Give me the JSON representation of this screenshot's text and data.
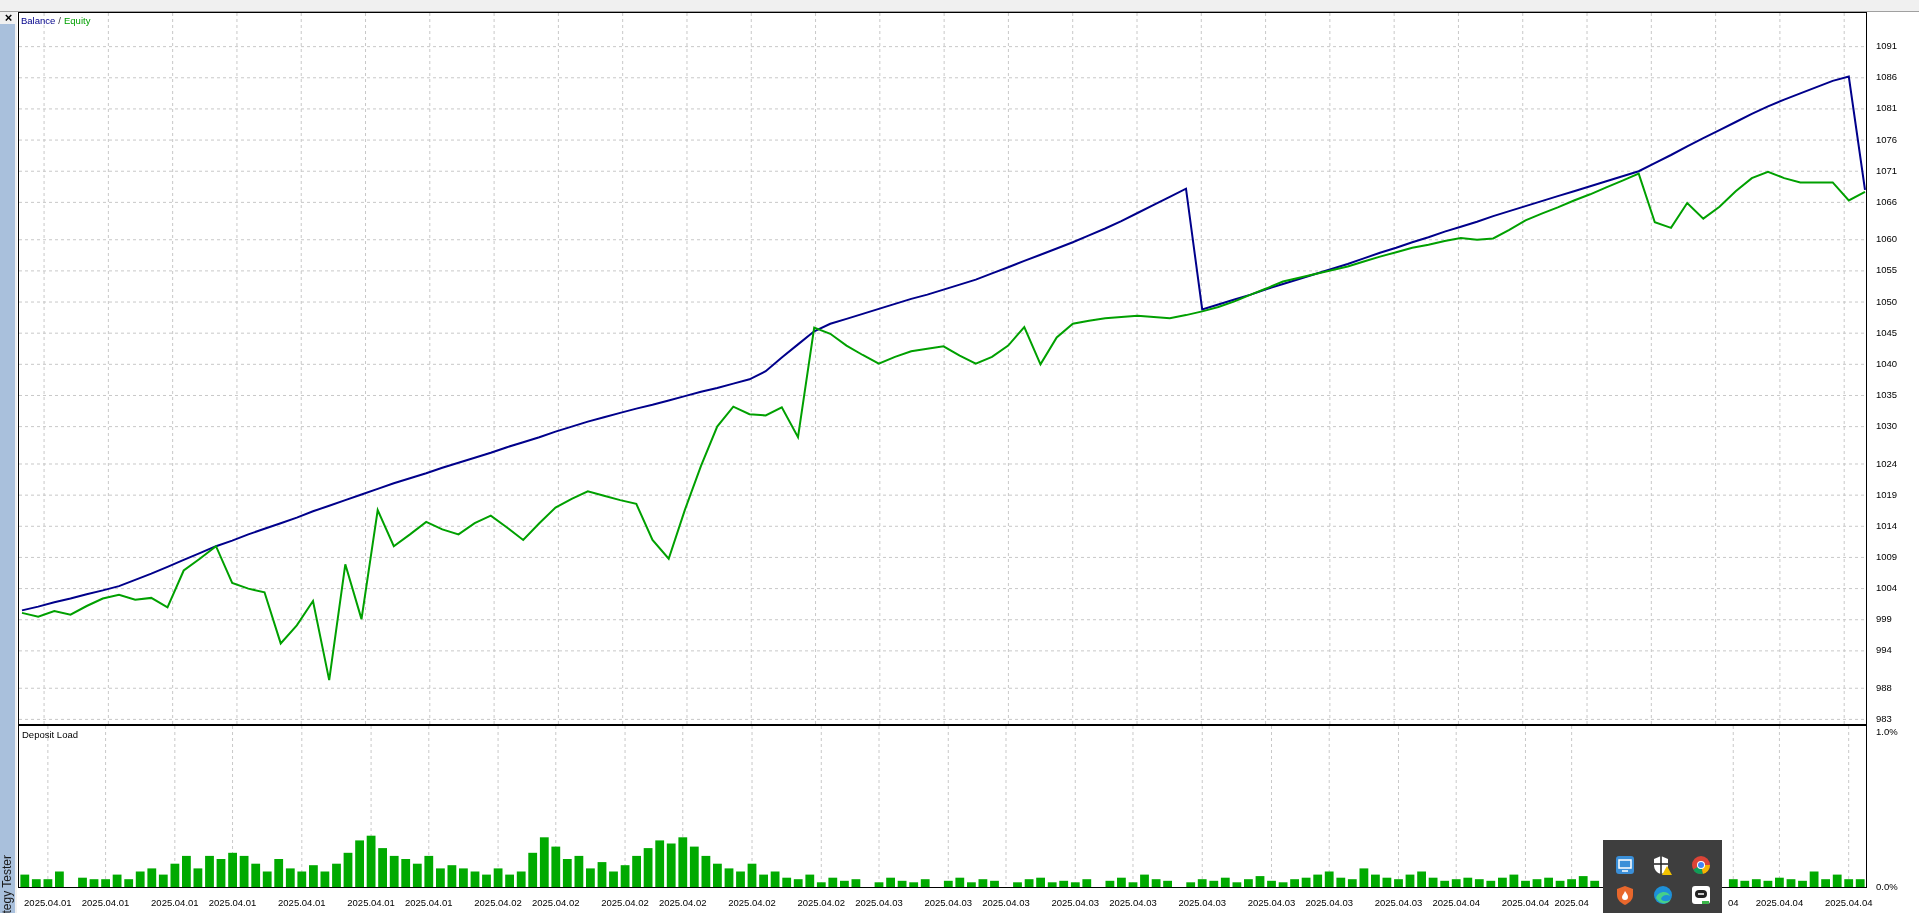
{
  "top_strip": {
    "kind": "frame"
  },
  "side_panel": {
    "close": "×",
    "tab_label": "tegy Tester"
  },
  "equity_chart": {
    "legend_separator": "/",
    "chart_data": {
      "type": "line",
      "grid": true,
      "ylim": [
        982.1,
        1096.4
      ],
      "yticks": [
        1091,
        1086,
        1081,
        1076,
        1071,
        1066,
        1060,
        1055,
        1050,
        1045,
        1040,
        1035,
        1030,
        1024,
        1019,
        1014,
        1009,
        1004,
        999,
        994,
        988,
        983
      ],
      "categories": [
        null,
        null,
        null,
        null,
        null,
        null,
        null,
        null,
        null,
        null,
        null,
        null,
        null,
        null,
        null,
        null,
        null,
        null,
        null,
        null,
        null,
        null,
        null,
        null,
        null,
        null,
        null,
        null,
        null,
        null,
        null,
        null,
        null,
        null,
        null,
        null,
        null,
        null,
        null,
        null,
        null,
        null,
        null,
        null,
        null,
        null,
        null,
        null,
        null,
        null,
        null,
        null,
        null,
        null,
        null,
        null,
        null,
        null,
        null,
        null,
        null,
        null,
        null,
        null,
        null,
        null,
        null,
        null,
        null,
        null,
        null,
        null,
        null,
        null,
        null,
        null,
        null,
        null,
        null,
        null,
        null,
        null,
        null,
        null,
        null,
        null,
        null,
        null,
        null,
        null,
        null,
        null,
        null,
        null,
        null,
        null,
        null,
        null,
        null,
        null,
        null,
        null,
        null,
        null,
        null,
        null,
        null,
        null,
        null,
        null,
        null,
        null,
        null,
        null,
        null
      ],
      "series": [
        {
          "name": "Balance",
          "color": "#00008b",
          "values": [
            1000.5,
            1001.1,
            1001.8,
            1002.4,
            1003.1,
            1003.7,
            1004.4,
            1005.4,
            1006.4,
            1007.5,
            1008.6,
            1009.7,
            1010.8,
            1011.7,
            1012.7,
            1013.6,
            1014.5,
            1015.4,
            1016.4,
            1017.3,
            1018.2,
            1019.1,
            1020,
            1020.9,
            1021.7,
            1022.5,
            1023.4,
            1024.2,
            1025,
            1025.8,
            1026.7,
            1027.5,
            1028.3,
            1029.2,
            1030,
            1030.8,
            1031.5,
            1032.2,
            1032.9,
            1033.5,
            1034.2,
            1034.9,
            1035.6,
            1036.2,
            1036.9,
            1037.6,
            1038.9,
            1041.1,
            1043.2,
            1045.3,
            1046.5,
            1047.3,
            1048.1,
            1048.9,
            1049.7,
            1050.5,
            1051.2,
            1052,
            1052.8,
            1053.6,
            1054.6,
            1055.6,
            1056.6,
            1057.6,
            1058.6,
            1059.6,
            1060.7,
            1061.8,
            1063,
            1064.3,
            1065.6,
            1066.9,
            1068.2,
            1048.8,
            1049.6,
            1050.4,
            1051.2,
            1052.1,
            1052.9,
            1053.7,
            1054.5,
            1055.3,
            1056.1,
            1057,
            1057.9,
            1058.7,
            1059.6,
            1060.4,
            1061.3,
            1062.1,
            1062.9,
            1063.8,
            1064.6,
            1065.4,
            1066.2,
            1067,
            1067.8,
            1068.6,
            1069.4,
            1070.2,
            1071,
            1072.3,
            1073.6,
            1075,
            1076.3,
            1077.6,
            1078.9,
            1080.2,
            1081.4,
            1082.5,
            1083.5,
            1084.5,
            1085.5,
            1086.2,
            1068
          ]
        },
        {
          "name": "Equity",
          "color": "#00a000",
          "values": [
            1000.1,
            999.5,
            1000.4,
            999.8,
            1001.2,
            1002.4,
            1003,
            1002.2,
            1002.5,
            1001,
            1006.9,
            1008.8,
            1010.8,
            1004.9,
            1004,
            1003.4,
            995.2,
            998.1,
            1002,
            989.3,
            1007.9,
            999.1,
            1016.6,
            1010.8,
            1012.7,
            1014.7,
            1013.5,
            1012.7,
            1014.5,
            1015.7,
            1013.8,
            1011.8,
            1014.5,
            1017,
            1018.4,
            1019.6,
            1018.9,
            1018.2,
            1017.6,
            1011.8,
            1008.8,
            1016.6,
            1023.7,
            1030,
            1033.2,
            1032,
            1031.8,
            1033.1,
            1028.3,
            1045.9,
            1044.9,
            1043,
            1041.5,
            1040.1,
            1041.2,
            1042.1,
            1042.5,
            1042.9,
            1041.4,
            1040.1,
            1041.2,
            1043,
            1046,
            1040,
            1044.3,
            1046.5,
            1047,
            1047.4,
            1047.6,
            1047.8,
            1047.6,
            1047.4,
            1047.9,
            1048.5,
            1049.2,
            1050.1,
            1051.2,
            1052.2,
            1053.3,
            1053.9,
            1054.5,
            1055.1,
            1055.7,
            1056.5,
            1057.3,
            1058,
            1058.7,
            1059.2,
            1059.8,
            1060.3,
            1060,
            1060.2,
            1061.6,
            1063.1,
            1064.2,
            1065.2,
            1066.3,
            1067.3,
            1068.4,
            1069.5,
            1070.6,
            1062.8,
            1061.9,
            1065.9,
            1063.4,
            1065.3,
            1067.8,
            1069.9,
            1070.9,
            1069.9,
            1069.2,
            1069.2,
            1069.2,
            1066.3,
            1067.7
          ]
        }
      ]
    }
  },
  "deposit_chart": {
    "chart_data": {
      "type": "bar",
      "title": "Deposit Load",
      "grid": true,
      "ylim": [
        0,
        1.036
      ],
      "yticks": [
        {
          "value": 1,
          "label": "1.0%"
        },
        {
          "value": 0,
          "label": "0.0%"
        }
      ],
      "categories": [
        null,
        null,
        "2025.04.01",
        null,
        null,
        null,
        null,
        "2025.04.01",
        null,
        null,
        null,
        null,
        null,
        "2025.04.01",
        null,
        null,
        null,
        null,
        "2025.04.01",
        null,
        null,
        null,
        null,
        null,
        "2025.04.01",
        null,
        null,
        null,
        null,
        null,
        "2025.04.01",
        null,
        null,
        null,
        null,
        "2025.04.01",
        null,
        null,
        null,
        null,
        null,
        "2025.04.02",
        null,
        null,
        null,
        null,
        "2025.04.02",
        null,
        null,
        null,
        null,
        null,
        "2025.04.02",
        null,
        null,
        null,
        null,
        "2025.04.02",
        null,
        null,
        null,
        null,
        null,
        "2025.04.02",
        null,
        null,
        null,
        null,
        null,
        "2025.04.02",
        null,
        null,
        null,
        null,
        "2025.04.03",
        null,
        null,
        null,
        null,
        null,
        "2025.04.03",
        null,
        null,
        null,
        null,
        "2025.04.03",
        null,
        null,
        null,
        null,
        null,
        "2025.04.03",
        null,
        null,
        null,
        null,
        "2025.04.03",
        null,
        null,
        null,
        null,
        null,
        "2025.04.03",
        null,
        null,
        null,
        null,
        null,
        "2025.04.03",
        null,
        null,
        null,
        null,
        "2025.04.03",
        null,
        null,
        null,
        null,
        null,
        "2025.04.03",
        null,
        null,
        null,
        null,
        "2025.04.04",
        null,
        null,
        null,
        null,
        null,
        "2025.04.04",
        null,
        null,
        null,
        "2025.04",
        null,
        null,
        null,
        null,
        null,
        null,
        null,
        null,
        null,
        null,
        null,
        null,
        null,
        "04",
        null,
        null,
        null,
        "2025.04.04",
        null,
        null,
        null,
        null,
        null,
        "2025.04.04",
        null
      ],
      "values": [
        0.08,
        0.05,
        0.05,
        0.1,
        0,
        0.06,
        0.05,
        0.05,
        0.08,
        0.05,
        0.1,
        0.12,
        0.08,
        0.15,
        0.2,
        0.12,
        0.2,
        0.18,
        0.22,
        0.2,
        0.15,
        0.1,
        0.18,
        0.12,
        0.1,
        0.14,
        0.1,
        0.15,
        0.22,
        0.3,
        0.33,
        0.25,
        0.2,
        0.18,
        0.15,
        0.2,
        0.12,
        0.14,
        0.12,
        0.1,
        0.08,
        0.12,
        0.08,
        0.1,
        0.22,
        0.32,
        0.26,
        0.18,
        0.2,
        0.12,
        0.16,
        0.1,
        0.14,
        0.2,
        0.25,
        0.3,
        0.28,
        0.32,
        0.26,
        0.2,
        0.15,
        0.12,
        0.1,
        0.15,
        0.08,
        0.1,
        0.06,
        0.05,
        0.08,
        0.03,
        0.06,
        0.04,
        0.05,
        0,
        0.03,
        0.06,
        0.04,
        0.03,
        0.05,
        0,
        0.04,
        0.06,
        0.03,
        0.05,
        0.04,
        0,
        0.03,
        0.05,
        0.06,
        0.03,
        0.04,
        0.03,
        0.05,
        0,
        0.04,
        0.06,
        0.03,
        0.08,
        0.05,
        0.04,
        0,
        0.03,
        0.05,
        0.04,
        0.06,
        0.03,
        0.05,
        0.07,
        0.04,
        0.03,
        0.05,
        0.06,
        0.08,
        0.1,
        0.06,
        0.05,
        0.12,
        0.08,
        0.06,
        0.05,
        0.08,
        0.1,
        0.06,
        0.04,
        0.05,
        0.06,
        0.05,
        0.04,
        0.06,
        0.08,
        0.04,
        0.05,
        0.06,
        0.04,
        0.05,
        0.07,
        0.04,
        null,
        null,
        null,
        null,
        null,
        null,
        null,
        null,
        null,
        null,
        null,
        0.05,
        0.04,
        0.05,
        0.04,
        0.06,
        0.05,
        0.04,
        0.1,
        0.05,
        0.08,
        0.05,
        0.05
      ]
    }
  },
  "tray_popup": {
    "icons": [
      {
        "kind": "monitor"
      },
      {
        "kind": "shield-warning"
      },
      {
        "kind": "circle-logo"
      },
      {
        "kind": "flame-shield"
      },
      {
        "kind": "swirl"
      },
      {
        "kind": "chat"
      }
    ]
  }
}
